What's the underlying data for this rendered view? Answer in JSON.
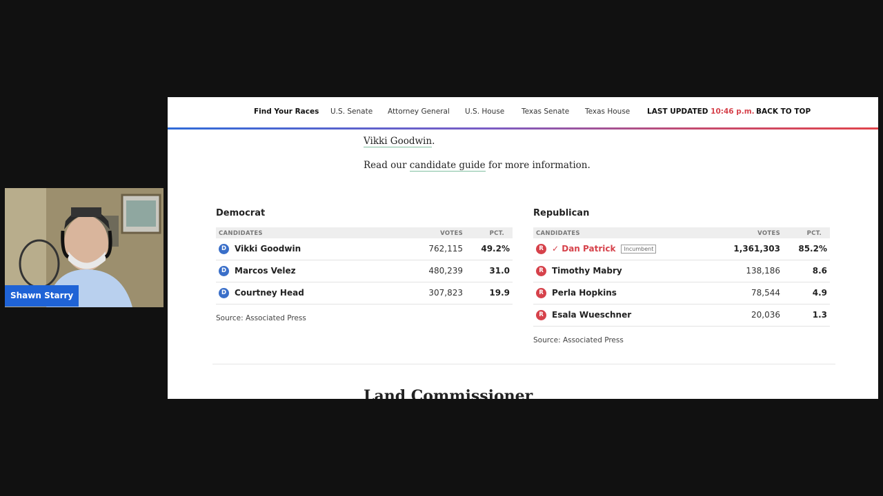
{
  "meeting": {
    "participant_name": "Shawn Starry"
  },
  "nav": {
    "items": [
      "Find Your Races",
      "U.S. Senate",
      "Attorney General",
      "U.S. House",
      "Texas Senate",
      "Texas House"
    ],
    "last_updated_label": "LAST UPDATED",
    "last_updated_time": "10:46 p.m.",
    "back_to_top": "BACK TO TOP"
  },
  "article": {
    "link_name": "Vikki Goodwin",
    "guide_prefix": "Read our ",
    "guide_link": "candidate guide",
    "guide_suffix": " for more information.",
    "next_section": "Land Commissioner"
  },
  "table_headers": {
    "candidates": "CANDIDATES",
    "votes": "VOTES",
    "pct": "PCT."
  },
  "democrat": {
    "title": "Democrat",
    "party_letter": "D",
    "candidates": [
      {
        "name": "Vikki Goodwin",
        "votes": "762,115",
        "pct": "49.2%"
      },
      {
        "name": "Marcos Velez",
        "votes": "480,239",
        "pct": "31.0"
      },
      {
        "name": "Courtney Head",
        "votes": "307,823",
        "pct": "19.9"
      }
    ],
    "source": "Source: Associated Press"
  },
  "republican": {
    "title": "Republican",
    "party_letter": "R",
    "candidates": [
      {
        "name": "✓ Dan Patrick",
        "votes": "1,361,303",
        "pct": "85.2%",
        "tag": "Incumbent"
      },
      {
        "name": "Timothy Mabry",
        "votes": "138,186",
        "pct": "8.6"
      },
      {
        "name": "Perla Hopkins",
        "votes": "78,544",
        "pct": "4.9"
      },
      {
        "name": "Esala Wueschner",
        "votes": "20,036",
        "pct": "1.3"
      }
    ],
    "source": "Source: Associated Press"
  },
  "colors": {
    "dem": "#3a6fc9",
    "rep": "#d6424b",
    "meeting_tag": "#1f63d6"
  }
}
